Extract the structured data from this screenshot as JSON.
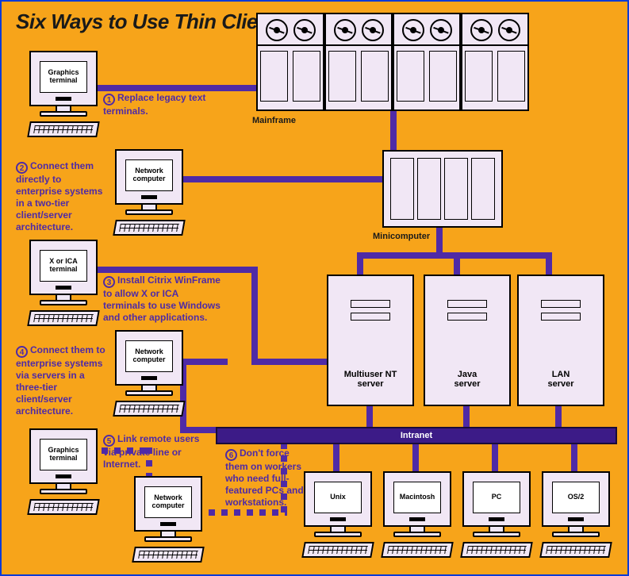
{
  "title": "Six Ways to Use Thin Clients",
  "terminals": {
    "t1": "Graphics\nterminal",
    "t2": "Network\ncomputer",
    "t3": "X or ICA\nterminal",
    "t4": "Network\ncomputer",
    "t5": "Graphics\nterminal",
    "t6": "Network\ncomputer"
  },
  "notes": {
    "n1": "Replace legacy text terminals.",
    "n2": "Connect them directly to enterprise systems in a two-tier client/server architecture.",
    "n3": "Install Citrix WinFrame to allow X or ICA terminals to use Windows and other applications.",
    "n4": "Connect them to enterprise systems via servers in a three-tier client/server architecture.",
    "n5": "Link remote users via private line or Internet.",
    "n6": "Don't force them on workers who need full-featured PCs and workstations."
  },
  "badges": {
    "b1": "1",
    "b2": "2",
    "b3": "3",
    "b4": "4",
    "b5": "5",
    "b6": "6"
  },
  "labels": {
    "mainframe": "Mainframe",
    "minicomputer": "Minicomputer",
    "nt": "Multiuser NT\nserver",
    "java": "Java\nserver",
    "lan": "LAN\nserver",
    "intranet": "Intranet"
  },
  "workstations": {
    "w1": "Unix",
    "w2": "Macintosh",
    "w3": "PC",
    "w4": "OS/2"
  }
}
